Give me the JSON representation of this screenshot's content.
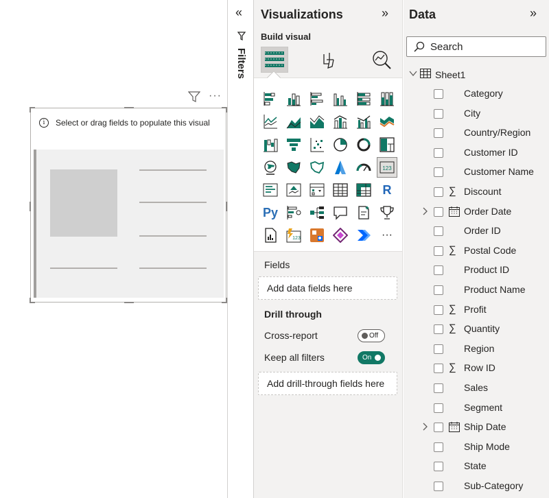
{
  "canvas": {
    "visual_hint": "Select or drag fields to populate this visual",
    "more_glyph": "···"
  },
  "filters": {
    "collapse_glyph": "«",
    "label": "Filters"
  },
  "visualizations": {
    "title": "Visualizations",
    "expand_glyph": "»",
    "build_label": "Build visual",
    "tabs": [
      "build-visual",
      "format-visual",
      "analytics"
    ],
    "fields_label": "Fields",
    "fields_well": "Add data fields here",
    "drill_label": "Drill through",
    "cross_report_label": "Cross-report",
    "cross_report_state": "Off",
    "keep_filters_label": "Keep all filters",
    "keep_filters_state": "On",
    "drill_well": "Add drill-through fields here",
    "gallery_text": {
      "r_visual": "R",
      "python_visual": "Py",
      "more": "···",
      "card_value": "123"
    },
    "accent": "#117865"
  },
  "data": {
    "title": "Data",
    "expand_glyph": "»",
    "search_placeholder": "Search",
    "table_name": "Sheet1",
    "fields": [
      {
        "name": "Category",
        "sigma": false,
        "date": false
      },
      {
        "name": "City",
        "sigma": false,
        "date": false
      },
      {
        "name": "Country/Region",
        "sigma": false,
        "date": false
      },
      {
        "name": "Customer ID",
        "sigma": false,
        "date": false
      },
      {
        "name": "Customer Name",
        "sigma": false,
        "date": false
      },
      {
        "name": "Discount",
        "sigma": true,
        "date": false
      },
      {
        "name": "Order Date",
        "sigma": false,
        "date": true
      },
      {
        "name": "Order ID",
        "sigma": false,
        "date": false
      },
      {
        "name": "Postal Code",
        "sigma": true,
        "date": false
      },
      {
        "name": "Product ID",
        "sigma": false,
        "date": false
      },
      {
        "name": "Product Name",
        "sigma": false,
        "date": false
      },
      {
        "name": "Profit",
        "sigma": true,
        "date": false
      },
      {
        "name": "Quantity",
        "sigma": true,
        "date": false
      },
      {
        "name": "Region",
        "sigma": false,
        "date": false
      },
      {
        "name": "Row ID",
        "sigma": true,
        "date": false
      },
      {
        "name": "Sales",
        "sigma": false,
        "date": false
      },
      {
        "name": "Segment",
        "sigma": false,
        "date": false
      },
      {
        "name": "Ship Date",
        "sigma": false,
        "date": true
      },
      {
        "name": "Ship Mode",
        "sigma": false,
        "date": false
      },
      {
        "name": "State",
        "sigma": false,
        "date": false
      },
      {
        "name": "Sub-Category",
        "sigma": false,
        "date": false
      }
    ]
  }
}
